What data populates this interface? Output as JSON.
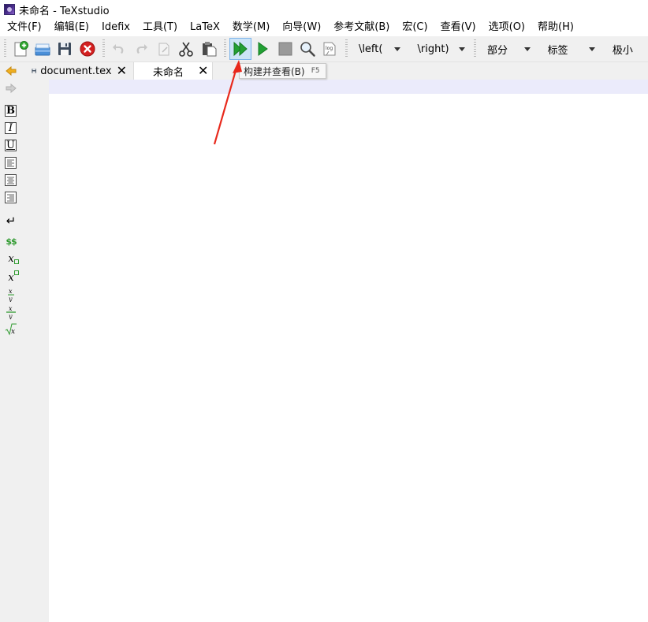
{
  "window": {
    "title": "未命名 - TeXstudio",
    "accent": "#3a2a70"
  },
  "menu": {
    "items": [
      "文件(F)",
      "编辑(E)",
      "Idefix",
      "工具(T)",
      "LaTeX",
      "数学(M)",
      "向导(W)",
      "参考文献(B)",
      "宏(C)",
      "查看(V)",
      "选项(O)",
      "帮助(H)"
    ]
  },
  "toolbar": {
    "icons": {
      "new": "new-document-icon",
      "open": "open-folder-icon",
      "save": "save-icon",
      "close": "close-document-icon",
      "undo": "undo-icon",
      "redo": "redo-icon",
      "copy": "copy-icon",
      "cut": "cut-icon",
      "paste": "paste-icon",
      "build_view": "build-and-view-icon",
      "compile": "compile-icon",
      "stop": "stop-icon",
      "view": "view-magnifier-icon",
      "log": "log-icon"
    },
    "combos": {
      "left": "\\left(",
      "right": "\\right)",
      "section": "部分",
      "label": "标签",
      "size": "极小"
    },
    "build_color": "#1f8a2b"
  },
  "tabs": [
    {
      "label": "document.tex",
      "icon": "save-icon",
      "active": false
    },
    {
      "label": "未命名",
      "active": true
    }
  ],
  "tooltip": {
    "text": "构建并查看(B)",
    "shortcut": "F5"
  },
  "sidebar": {
    "nav": [
      "back-arrow-icon",
      "forward-arrow-icon"
    ],
    "format": [
      {
        "icon": "bold-icon",
        "glyph": "B"
      },
      {
        "icon": "italic-icon",
        "glyph": "I"
      },
      {
        "icon": "underline-icon",
        "glyph": "U"
      },
      {
        "icon": "align-left-icon"
      },
      {
        "icon": "align-center-icon"
      },
      {
        "icon": "align-right-icon"
      },
      {
        "icon": "newline-icon",
        "glyph": "↵"
      },
      {
        "icon": "math-mode-icon",
        "glyph": "$$"
      },
      {
        "icon": "subscript-icon",
        "glyph": "x"
      },
      {
        "icon": "superscript-icon",
        "glyph": "x"
      },
      {
        "icon": "fraction-icon",
        "glyph": "x/y"
      },
      {
        "icon": "dfrac-icon",
        "glyph": "x/y"
      },
      {
        "icon": "sqrt-icon",
        "glyph": "√x"
      }
    ]
  },
  "annotation": {
    "arrow_color": "#e8291c",
    "target": "build-and-view-button"
  }
}
